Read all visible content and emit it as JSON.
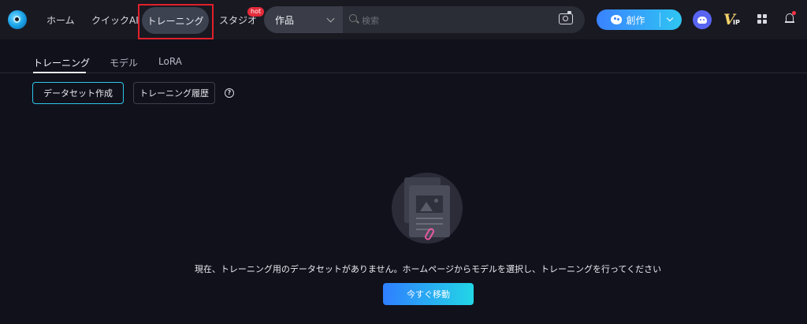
{
  "nav": {
    "items": [
      "ホーム",
      "クイックAI",
      "トレーニング",
      "スタジオ"
    ],
    "hot_badge": "hot"
  },
  "search": {
    "category": "作品",
    "placeholder": "検索"
  },
  "header": {
    "create_label": "創作"
  },
  "subtabs": [
    "トレーニング",
    "モデル",
    "LoRA"
  ],
  "actions": {
    "create_dataset": "データセット作成",
    "training_history": "トレーニング履歴"
  },
  "empty_state": {
    "message": "現在、トレーニング用のデータセットがありません。ホームページからモデルを選択し、トレーニングを行ってください",
    "cta": "今すぐ移動"
  },
  "colors": {
    "accent_start": "#3a82ff",
    "accent_end": "#2fc6f2",
    "highlight": "#e0202a",
    "hot": "#e32b3a"
  },
  "icons": [
    "logo-icon",
    "chevron-down-icon",
    "search-icon",
    "camera-icon",
    "palette-icon",
    "discord-icon",
    "vip-icon",
    "apps-grid-icon",
    "bell-icon",
    "help-icon",
    "empty-dataset-icon",
    "paperclip-icon"
  ]
}
